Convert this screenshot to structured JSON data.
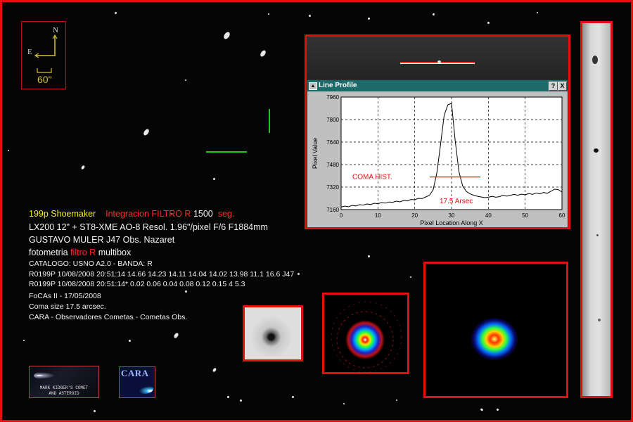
{
  "compass": {
    "north": "N",
    "east": "E",
    "scale": "60\""
  },
  "info": {
    "object": "199p Shoemaker",
    "integration_prefix": "Integracion FILTRO R",
    "integration_value": "1500",
    "integration_unit": "seg.",
    "equipment": "LX200 12\" +  ST8-XME AO-8  Resol. 1.96\"/pixel  F/6  F1884mm",
    "observer": "GUSTAVO MULER  J47 Obs. Nazaret",
    "photometry_prefix": "fotometria",
    "photometry_filter": "filtro  R",
    "photometry_suffix": "multibox",
    "catalog": "CATALOGO: USNO A2.0 - BANDA: R",
    "line1": "R0199P 10/08/2008 20:51:14 14.66 14.23 14.11 14.04 14.02 13.98 11.1 16.6 J47",
    "line2": "R0199P 10/08/2008 20:51:14* 0.02 0.06 0.04 0.08 0.12 0.15 4 5.3",
    "software": "FoCAs II - 17/05/2008",
    "coma": "Coma size 17.5 arcsec.",
    "credits": "CARA -  Observadores Cometas  -  Cometas Obs."
  },
  "line_profile": {
    "title": "Line Profile",
    "help_btn": "?",
    "close_btn": "X",
    "coma_label": "COMA HIST.",
    "arcsec_label": "17.5 Arsec"
  },
  "logos": {
    "mark_line1": "MARK KIDGER'S COMET",
    "mark_line2": "AND ASTEROID",
    "cara": "CARA"
  },
  "colors": {
    "frame": "#e01010",
    "title_bar": "#1c6a6a",
    "annotation": "#ff2a2a"
  },
  "chart_data": {
    "type": "line",
    "xlabel": "Pixel Location Along X",
    "ylabel": "Pixel Value",
    "xlim": [
      0,
      60
    ],
    "ylim": [
      7160,
      7960
    ],
    "xticks": [
      0,
      10,
      20,
      30,
      40,
      50,
      60
    ],
    "yticks": [
      7160,
      7320,
      7480,
      7640,
      7800,
      7960
    ],
    "grid": true,
    "series": [
      {
        "x": [
          0,
          1,
          2,
          3,
          4,
          5,
          6,
          7,
          8,
          9,
          10,
          11,
          12,
          13,
          14,
          15,
          16,
          17,
          18,
          19,
          20,
          21,
          22,
          23,
          24,
          25,
          26,
          27,
          28,
          29,
          30,
          31,
          32,
          33,
          34,
          35,
          36,
          37,
          38,
          39,
          40,
          41,
          42,
          43,
          44,
          45,
          46,
          47,
          48,
          49,
          50,
          51,
          52,
          53,
          54,
          55,
          56,
          57,
          58,
          59,
          60
        ],
        "values": [
          7178,
          7185,
          7180,
          7190,
          7186,
          7195,
          7192,
          7200,
          7196,
          7205,
          7202,
          7210,
          7206,
          7214,
          7212,
          7220,
          7215,
          7225,
          7222,
          7232,
          7230,
          7240,
          7238,
          7250,
          7262,
          7300,
          7420,
          7620,
          7830,
          7905,
          7915,
          7650,
          7430,
          7330,
          7290,
          7272,
          7262,
          7255,
          7250,
          7245,
          7248,
          7254,
          7248,
          7252,
          7262,
          7256,
          7262,
          7268,
          7262,
          7270,
          7265,
          7274,
          7268,
          7278,
          7272,
          7282,
          7276,
          7290,
          7305,
          7302,
          7285
        ]
      }
    ]
  }
}
